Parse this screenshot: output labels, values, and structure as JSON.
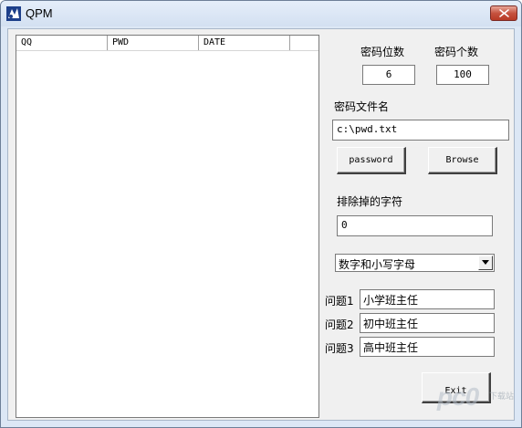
{
  "window": {
    "title": "QPM"
  },
  "list": {
    "columns": [
      "QQ",
      "PWD",
      "DATE",
      ""
    ]
  },
  "form": {
    "length_label": "密码位数",
    "length_value": "6",
    "count_label": "密码个数",
    "count_value": "100",
    "file_label": "密码文件名",
    "file_value": "c:\\pwd.txt",
    "password_button": "password",
    "browse_button": "Browse",
    "exclude_label": "排除掉的字符",
    "exclude_value": "0",
    "charset_selected": "数字和小写字母",
    "q1_label": "问题1",
    "q1_value": "小学班主任",
    "q2_label": "问题2",
    "q2_value": "初中班主任",
    "q3_label": "问题3",
    "q3_value": "高中班主任",
    "exit_button": "Exit"
  },
  "watermark": {
    "text": "pc0",
    "small": "下载站"
  },
  "icons": {
    "app": "app-icon",
    "close": "close-icon",
    "dropdown": "chevron-down-icon"
  },
  "colors": {
    "titlebar": "#dce7f5",
    "close": "#c6523f",
    "face": "#f0f0f0"
  }
}
